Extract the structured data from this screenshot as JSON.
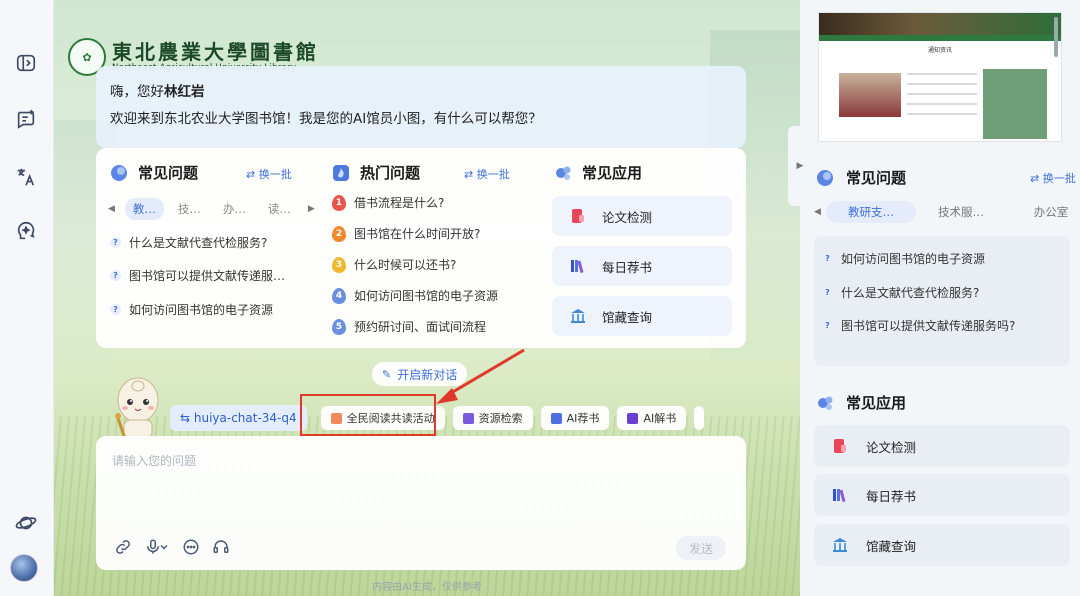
{
  "library": {
    "name_cn": "東北農業大學圖書館",
    "name_en": "Northeast Agricultural University Library"
  },
  "welcome": {
    "greeting_prefix": "嗨，您好",
    "user_name": "林红岩",
    "message": "欢迎来到东北农业大学图书馆！我是您的AI馆员小图，有什么可以帮您？"
  },
  "faq": {
    "title": "常见问题",
    "refresh": "换一批",
    "categories": [
      "教…",
      "技…",
      "办…",
      "读…"
    ],
    "questions": [
      "什么是文献代查代检服务?",
      "图书馆可以提供文献传递服…",
      "如何访问图书馆的电子资源"
    ]
  },
  "hot": {
    "title": "热门问题",
    "refresh": "换一批",
    "questions": [
      {
        "num": "1",
        "text": "借书流程是什么?"
      },
      {
        "num": "2",
        "text": "图书馆在什么时间开放?"
      },
      {
        "num": "3",
        "text": "什么时候可以还书?"
      },
      {
        "num": "4",
        "text": "如何访问图书馆的电子资源"
      },
      {
        "num": "5",
        "text": "预约研讨间、面试间流程"
      }
    ]
  },
  "apps": {
    "title": "常见应用",
    "items": [
      "论文检测",
      "每日荐书",
      "馆藏查询"
    ]
  },
  "new_chat": "开启新对话",
  "toolbar": {
    "model": "huiya-chat-34-q4",
    "tools": [
      "全民阅读共读活动",
      "资源检索",
      "AI荐书",
      "AI解书"
    ]
  },
  "input": {
    "placeholder": "请输入您的问题",
    "send": "发送"
  },
  "disclaimer": "内容由AI生成，仅供参考",
  "right_panel": {
    "thumbnail_title": "通知资讯",
    "faq_title": "常见问题",
    "refresh": "换一批",
    "categories": [
      "教研支…",
      "技术服…",
      "办公室"
    ],
    "questions": [
      "如何访问图书馆的电子资源",
      "什么是文献代查代检服务?",
      "图书馆可以提供文献传递服务吗?"
    ],
    "apps_title": "常见应用",
    "apps": [
      "论文检测",
      "每日荐书",
      "馆藏查询"
    ]
  },
  "colors": {
    "accent": "#3f6fd8",
    "highlight": "#e0392b",
    "hot_colors": [
      "#e8554a",
      "#f08a2a",
      "#f2b630",
      "#6a8fe0",
      "#6a8fe0"
    ]
  }
}
